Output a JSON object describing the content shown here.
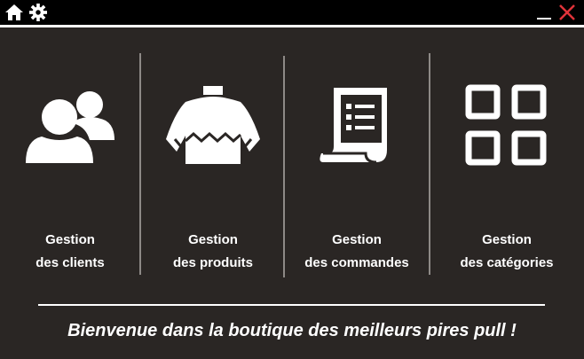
{
  "titlebar": {
    "home_icon": "home-icon",
    "settings_icon": "gear-icon",
    "minimize_icon": "minimize-icon",
    "close_icon": "close-icon",
    "close_color": "#e0333a"
  },
  "cards": [
    {
      "icon": "users-icon",
      "line1": "Gestion",
      "line2": "des clients"
    },
    {
      "icon": "sweater-icon",
      "line1": "Gestion",
      "line2": "des produits"
    },
    {
      "icon": "document-list-icon",
      "line1": "Gestion",
      "line2": "des commandes"
    },
    {
      "icon": "grid-categories-icon",
      "line1": "Gestion",
      "line2": "des catégories"
    }
  ],
  "footer": {
    "welcome": "Bienvenue dans la boutique des meilleurs pires pull !"
  },
  "colors": {
    "background": "#2a2624",
    "titlebar": "#000000",
    "text": "#ffffff",
    "divider": "#8d8986"
  }
}
